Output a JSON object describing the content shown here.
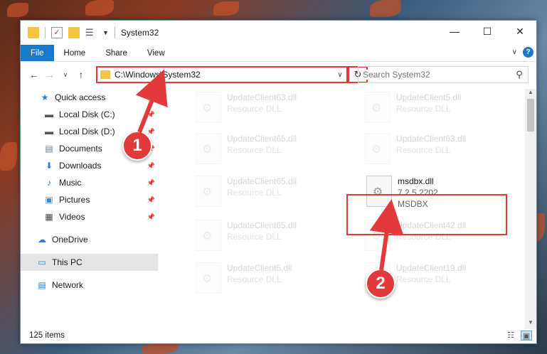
{
  "window": {
    "title": "System32",
    "min_glyph": "—",
    "max_glyph": "☐",
    "close_glyph": "✕"
  },
  "ribbon": {
    "tabs": [
      "File",
      "Home",
      "Share",
      "View"
    ],
    "expand_glyph": "∨",
    "help_glyph": "?"
  },
  "toolbar": {
    "back_glyph": "←",
    "forward_glyph": "→",
    "recent_glyph": "∨",
    "up_glyph": "↑",
    "address": "C:\\Windows\\System32",
    "address_chevron": "∨",
    "refresh_glyph": "↻",
    "search_placeholder": "Search System32",
    "search_glyph": "⚲"
  },
  "sidebar": {
    "items": [
      {
        "label": "Quick access",
        "icon": "star-icon",
        "glyph": "★",
        "pinned": false
      },
      {
        "label": "Local Disk (C:)",
        "icon": "drive-icon",
        "glyph": "▬",
        "pinned": true
      },
      {
        "label": "Local Disk (D:)",
        "icon": "drive-icon",
        "glyph": "▬",
        "pinned": true
      },
      {
        "label": "Documents",
        "icon": "documents-icon",
        "glyph": "▤",
        "pinned": true
      },
      {
        "label": "Downloads",
        "icon": "download-icon",
        "glyph": "⬇",
        "pinned": true
      },
      {
        "label": "Music",
        "icon": "music-icon",
        "glyph": "♪",
        "pinned": true
      },
      {
        "label": "Pictures",
        "icon": "pictures-icon",
        "glyph": "▣",
        "pinned": true
      },
      {
        "label": "Videos",
        "icon": "videos-icon",
        "glyph": "▦",
        "pinned": true
      }
    ],
    "onedrive": "OneDrive",
    "thispc": "This PC",
    "network": "Network",
    "pin_glyph": "📌"
  },
  "files": [
    {
      "name": "UpdateClient63.dll",
      "type": "Resource DLL"
    },
    {
      "name": "UpdateClient5.dll",
      "type": "Resource DLL"
    },
    {
      "name": "UpdateClient65.dll",
      "type": "Resource DLL"
    },
    {
      "name": "UpdateClient63.dll",
      "type": "Resource DLL"
    },
    {
      "name": "UpdateClient65.dll",
      "type": "Resource DLL"
    },
    {
      "name": "msdbx.dll",
      "version": "7.2.5.2202",
      "type": "MSDBX"
    },
    {
      "name": "UpdateClient65.dll",
      "type": "Resource DLL"
    },
    {
      "name": "UpdateClient42.dll",
      "type": "Resource DLL"
    },
    {
      "name": "UpdateClient5.dll",
      "type": "Resource DLL"
    },
    {
      "name": "UpdateClient19.dll",
      "type": "Resource DLL"
    }
  ],
  "status": {
    "count": "125 items"
  },
  "callouts": {
    "one": "1",
    "two": "2"
  },
  "colors": {
    "accent": "#1979ca",
    "highlight": "#e23a3a"
  }
}
